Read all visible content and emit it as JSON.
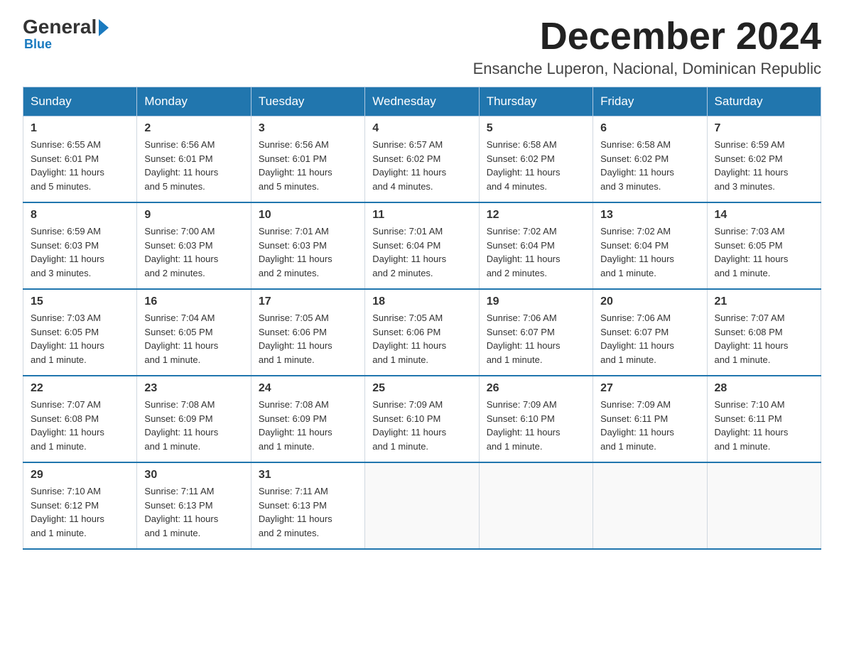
{
  "logo": {
    "general": "General",
    "blue": "Blue",
    "arrow_char": "▶"
  },
  "header": {
    "month_title": "December 2024",
    "location": "Ensanche Luperon, Nacional, Dominican Republic"
  },
  "days_of_week": [
    "Sunday",
    "Monday",
    "Tuesday",
    "Wednesday",
    "Thursday",
    "Friday",
    "Saturday"
  ],
  "weeks": [
    [
      {
        "day": "1",
        "info": "Sunrise: 6:55 AM\nSunset: 6:01 PM\nDaylight: 11 hours\nand 5 minutes."
      },
      {
        "day": "2",
        "info": "Sunrise: 6:56 AM\nSunset: 6:01 PM\nDaylight: 11 hours\nand 5 minutes."
      },
      {
        "day": "3",
        "info": "Sunrise: 6:56 AM\nSunset: 6:01 PM\nDaylight: 11 hours\nand 5 minutes."
      },
      {
        "day": "4",
        "info": "Sunrise: 6:57 AM\nSunset: 6:02 PM\nDaylight: 11 hours\nand 4 minutes."
      },
      {
        "day": "5",
        "info": "Sunrise: 6:58 AM\nSunset: 6:02 PM\nDaylight: 11 hours\nand 4 minutes."
      },
      {
        "day": "6",
        "info": "Sunrise: 6:58 AM\nSunset: 6:02 PM\nDaylight: 11 hours\nand 3 minutes."
      },
      {
        "day": "7",
        "info": "Sunrise: 6:59 AM\nSunset: 6:02 PM\nDaylight: 11 hours\nand 3 minutes."
      }
    ],
    [
      {
        "day": "8",
        "info": "Sunrise: 6:59 AM\nSunset: 6:03 PM\nDaylight: 11 hours\nand 3 minutes."
      },
      {
        "day": "9",
        "info": "Sunrise: 7:00 AM\nSunset: 6:03 PM\nDaylight: 11 hours\nand 2 minutes."
      },
      {
        "day": "10",
        "info": "Sunrise: 7:01 AM\nSunset: 6:03 PM\nDaylight: 11 hours\nand 2 minutes."
      },
      {
        "day": "11",
        "info": "Sunrise: 7:01 AM\nSunset: 6:04 PM\nDaylight: 11 hours\nand 2 minutes."
      },
      {
        "day": "12",
        "info": "Sunrise: 7:02 AM\nSunset: 6:04 PM\nDaylight: 11 hours\nand 2 minutes."
      },
      {
        "day": "13",
        "info": "Sunrise: 7:02 AM\nSunset: 6:04 PM\nDaylight: 11 hours\nand 1 minute."
      },
      {
        "day": "14",
        "info": "Sunrise: 7:03 AM\nSunset: 6:05 PM\nDaylight: 11 hours\nand 1 minute."
      }
    ],
    [
      {
        "day": "15",
        "info": "Sunrise: 7:03 AM\nSunset: 6:05 PM\nDaylight: 11 hours\nand 1 minute."
      },
      {
        "day": "16",
        "info": "Sunrise: 7:04 AM\nSunset: 6:05 PM\nDaylight: 11 hours\nand 1 minute."
      },
      {
        "day": "17",
        "info": "Sunrise: 7:05 AM\nSunset: 6:06 PM\nDaylight: 11 hours\nand 1 minute."
      },
      {
        "day": "18",
        "info": "Sunrise: 7:05 AM\nSunset: 6:06 PM\nDaylight: 11 hours\nand 1 minute."
      },
      {
        "day": "19",
        "info": "Sunrise: 7:06 AM\nSunset: 6:07 PM\nDaylight: 11 hours\nand 1 minute."
      },
      {
        "day": "20",
        "info": "Sunrise: 7:06 AM\nSunset: 6:07 PM\nDaylight: 11 hours\nand 1 minute."
      },
      {
        "day": "21",
        "info": "Sunrise: 7:07 AM\nSunset: 6:08 PM\nDaylight: 11 hours\nand 1 minute."
      }
    ],
    [
      {
        "day": "22",
        "info": "Sunrise: 7:07 AM\nSunset: 6:08 PM\nDaylight: 11 hours\nand 1 minute."
      },
      {
        "day": "23",
        "info": "Sunrise: 7:08 AM\nSunset: 6:09 PM\nDaylight: 11 hours\nand 1 minute."
      },
      {
        "day": "24",
        "info": "Sunrise: 7:08 AM\nSunset: 6:09 PM\nDaylight: 11 hours\nand 1 minute."
      },
      {
        "day": "25",
        "info": "Sunrise: 7:09 AM\nSunset: 6:10 PM\nDaylight: 11 hours\nand 1 minute."
      },
      {
        "day": "26",
        "info": "Sunrise: 7:09 AM\nSunset: 6:10 PM\nDaylight: 11 hours\nand 1 minute."
      },
      {
        "day": "27",
        "info": "Sunrise: 7:09 AM\nSunset: 6:11 PM\nDaylight: 11 hours\nand 1 minute."
      },
      {
        "day": "28",
        "info": "Sunrise: 7:10 AM\nSunset: 6:11 PM\nDaylight: 11 hours\nand 1 minute."
      }
    ],
    [
      {
        "day": "29",
        "info": "Sunrise: 7:10 AM\nSunset: 6:12 PM\nDaylight: 11 hours\nand 1 minute."
      },
      {
        "day": "30",
        "info": "Sunrise: 7:11 AM\nSunset: 6:13 PM\nDaylight: 11 hours\nand 1 minute."
      },
      {
        "day": "31",
        "info": "Sunrise: 7:11 AM\nSunset: 6:13 PM\nDaylight: 11 hours\nand 2 minutes."
      },
      {
        "day": "",
        "info": ""
      },
      {
        "day": "",
        "info": ""
      },
      {
        "day": "",
        "info": ""
      },
      {
        "day": "",
        "info": ""
      }
    ]
  ]
}
